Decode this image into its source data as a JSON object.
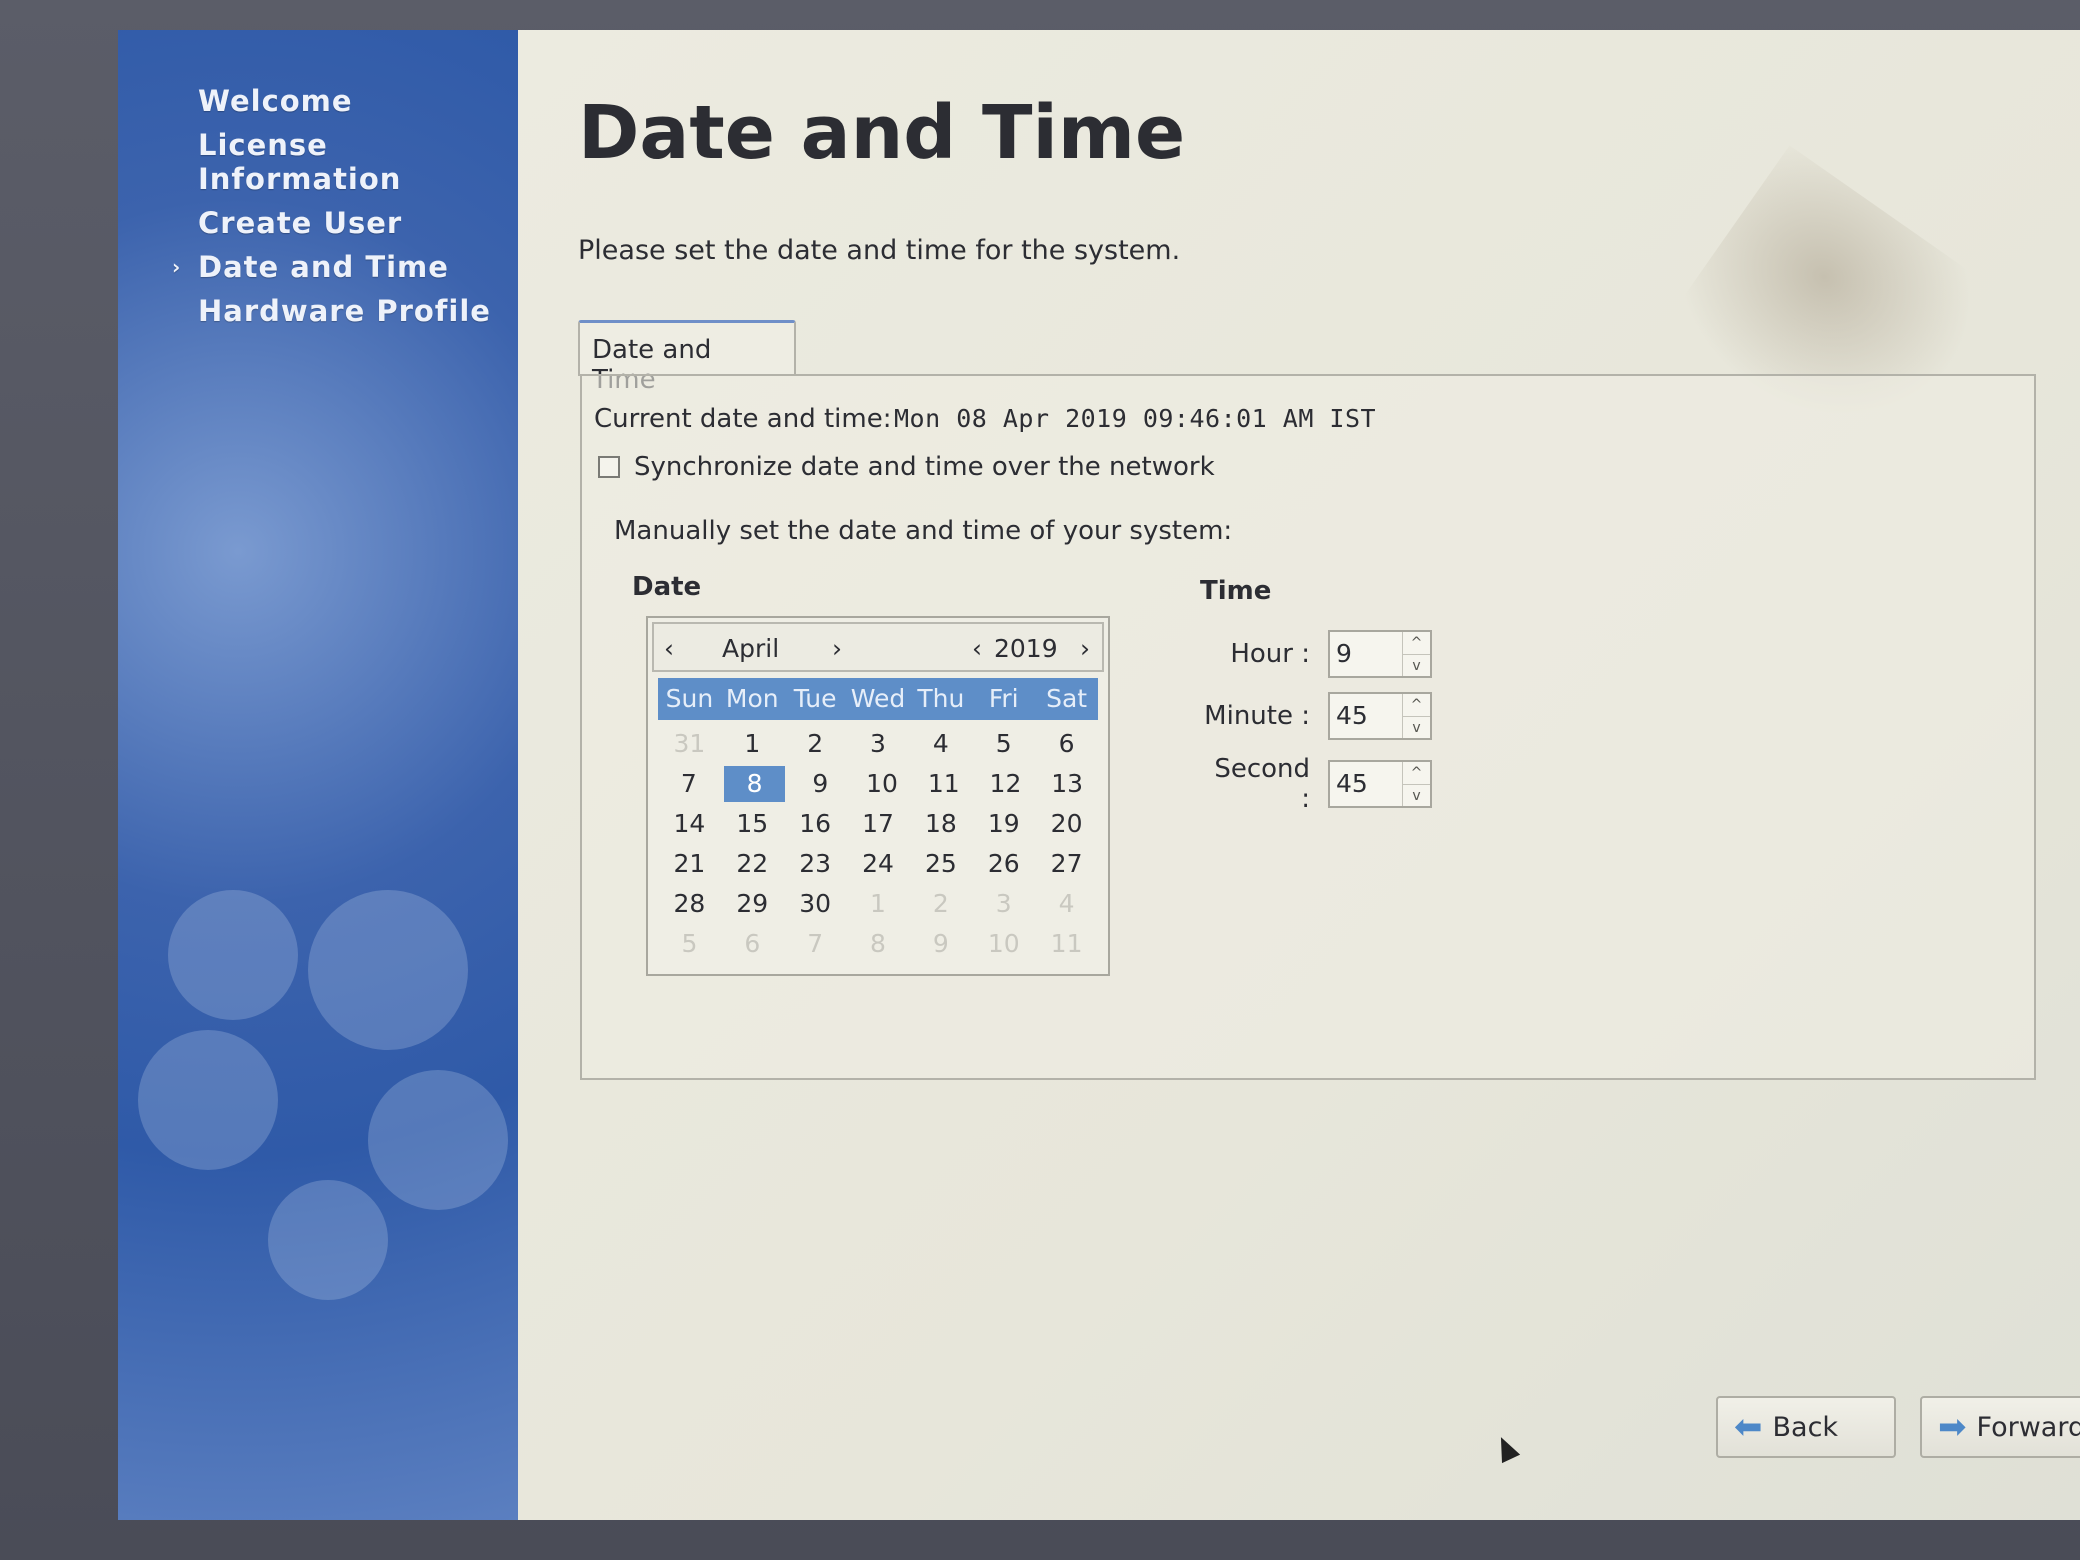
{
  "sidebar": {
    "items": [
      {
        "label": "Welcome"
      },
      {
        "label": "License\nInformation"
      },
      {
        "label": "Create User"
      },
      {
        "label": "Date and Time",
        "active": true,
        "marker": "›"
      },
      {
        "label": "Hardware Profile"
      }
    ]
  },
  "page": {
    "title": "Date and Time",
    "subtitle": "Please set the date and time for the system."
  },
  "tab": {
    "label": "Date and Time"
  },
  "current": {
    "label": "Current date and time:",
    "value": "Mon 08 Apr 2019 09:46:01 AM IST"
  },
  "sync": {
    "label": "Synchronize date and time over the network",
    "checked": false
  },
  "manual": {
    "label": "Manually set the date and time of your system:"
  },
  "date": {
    "heading": "Date",
    "month": "April",
    "year": "2019",
    "prev_month": "‹",
    "next_month": "›",
    "prev_year": "‹",
    "next_year": "›",
    "weekdays": [
      "Sun",
      "Mon",
      "Tue",
      "Wed",
      "Thu",
      "Fri",
      "Sat"
    ],
    "selected_day": "8",
    "weeks": [
      [
        {
          "d": "31",
          "o": true
        },
        {
          "d": "1"
        },
        {
          "d": "2"
        },
        {
          "d": "3"
        },
        {
          "d": "4"
        },
        {
          "d": "5"
        },
        {
          "d": "6"
        }
      ],
      [
        {
          "d": "7"
        },
        {
          "d": "8",
          "s": true
        },
        {
          "d": "9"
        },
        {
          "d": "10"
        },
        {
          "d": "11"
        },
        {
          "d": "12"
        },
        {
          "d": "13"
        }
      ],
      [
        {
          "d": "14"
        },
        {
          "d": "15"
        },
        {
          "d": "16"
        },
        {
          "d": "17"
        },
        {
          "d": "18"
        },
        {
          "d": "19"
        },
        {
          "d": "20"
        }
      ],
      [
        {
          "d": "21"
        },
        {
          "d": "22"
        },
        {
          "d": "23"
        },
        {
          "d": "24"
        },
        {
          "d": "25"
        },
        {
          "d": "26"
        },
        {
          "d": "27"
        }
      ],
      [
        {
          "d": "28"
        },
        {
          "d": "29"
        },
        {
          "d": "30"
        },
        {
          "d": "1",
          "o": true
        },
        {
          "d": "2",
          "o": true
        },
        {
          "d": "3",
          "o": true
        },
        {
          "d": "4",
          "o": true
        }
      ],
      [
        {
          "d": "5",
          "o": true
        },
        {
          "d": "6",
          "o": true
        },
        {
          "d": "7",
          "o": true
        },
        {
          "d": "8",
          "o": true
        },
        {
          "d": "9",
          "o": true
        },
        {
          "d": "10",
          "o": true
        },
        {
          "d": "11",
          "o": true
        }
      ]
    ]
  },
  "time": {
    "heading": "Time",
    "hour": {
      "label": "Hour :",
      "value": "9"
    },
    "minute": {
      "label": "Minute :",
      "value": "45"
    },
    "second": {
      "label": "Second :",
      "value": "45"
    },
    "up_icon": "^",
    "down_icon": "v"
  },
  "buttons": {
    "back": {
      "label": "Back",
      "icon": "arrow-left-icon"
    },
    "forward": {
      "label": "Forward",
      "icon": "arrow-right-icon"
    }
  },
  "colors": {
    "accent": "#5e8ec8",
    "sidebar": "#3c63ad",
    "background": "#e9e8dd"
  }
}
